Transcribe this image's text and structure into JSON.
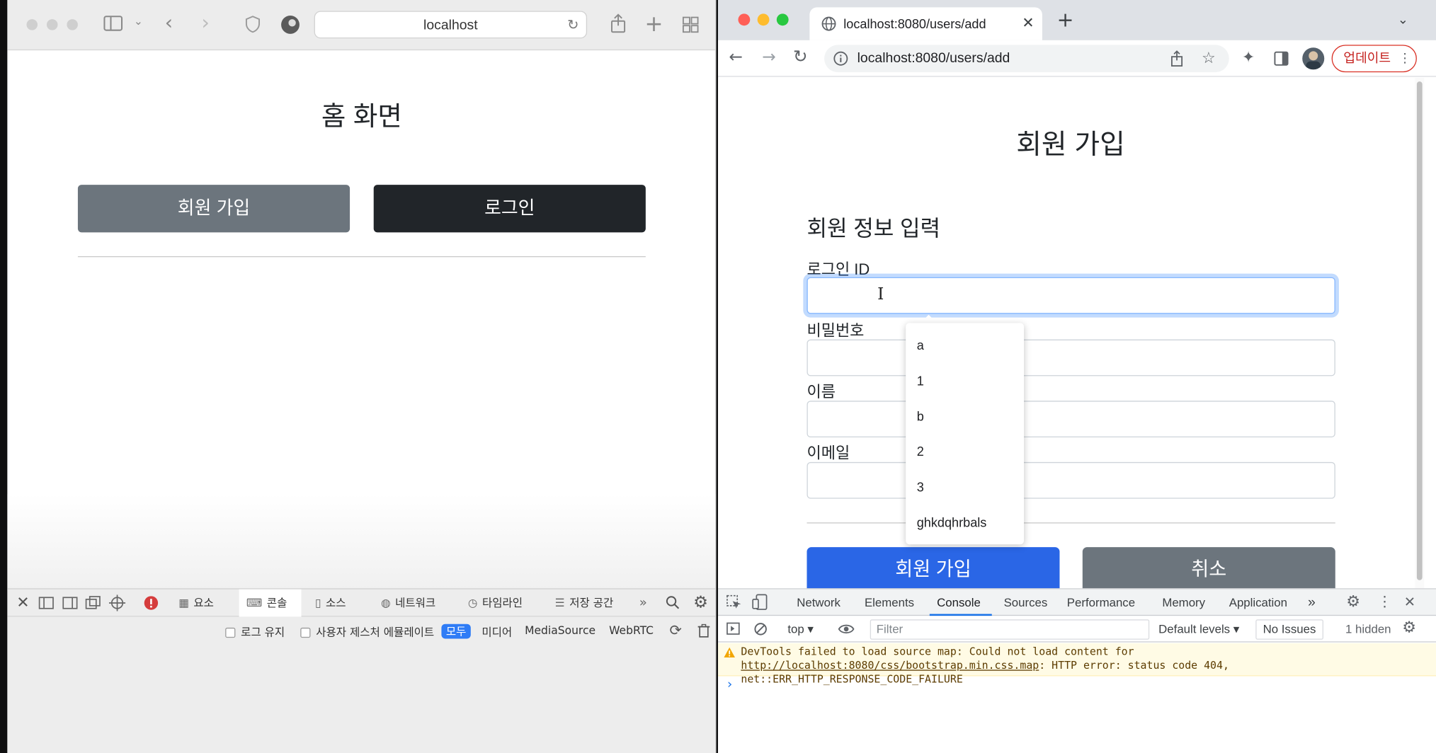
{
  "safari": {
    "address": "localhost",
    "page_title": "홈 화면",
    "signup_button": "회원 가입",
    "login_button": "로그인",
    "colors": {
      "signup": "#6c757d",
      "login": "#212529"
    },
    "devtools": {
      "tabs": [
        "요소",
        "콘솔",
        "소스",
        "네트워크",
        "타임라인",
        "저장 공간"
      ],
      "active_tab": "콘솔",
      "filter": {
        "preserve_log": "로그 유지",
        "gesture": "사용자 제스처 에뮬레이트",
        "all": "모두",
        "media": "미디어",
        "media_source": "MediaSource",
        "webrtc": "WebRTC"
      }
    }
  },
  "chrome": {
    "tab_title": "localhost:8080/users/add",
    "url": "localhost:8080/users/add",
    "update_button": "업데이트",
    "page_title": "회원 가입",
    "form_title": "회원 정보 입력",
    "fields": {
      "login_id": "로그인 ID",
      "password": "비밀번호",
      "name": "이름",
      "email": "이메일"
    },
    "autocomplete": [
      "a",
      "1",
      "b",
      "2",
      "3",
      "ghkdqhrbals"
    ],
    "submit_button": "회원 가입",
    "cancel_button": "취소",
    "colors": {
      "submit": "#2a66e6",
      "cancel": "#6c757d",
      "accent": "#1a73e8"
    },
    "devtools": {
      "tabs": [
        "Network",
        "Elements",
        "Console",
        "Sources",
        "Performance",
        "Memory",
        "Application"
      ],
      "active_tab": "Console",
      "context": "top ▾",
      "filter_placeholder": "Filter",
      "levels": "Default levels ▾",
      "issues": "No Issues",
      "hidden": "1 hidden",
      "warning_prefix": "DevTools failed to load source map: Could not load content for ",
      "warning_link": "http://localhost:8080/css/bootstrap.min.css.map",
      "warning_suffix": ": HTTP error: status code 404, net::ERR_HTTP_RESPONSE_CODE_FAILURE",
      "prompt": "›"
    }
  }
}
